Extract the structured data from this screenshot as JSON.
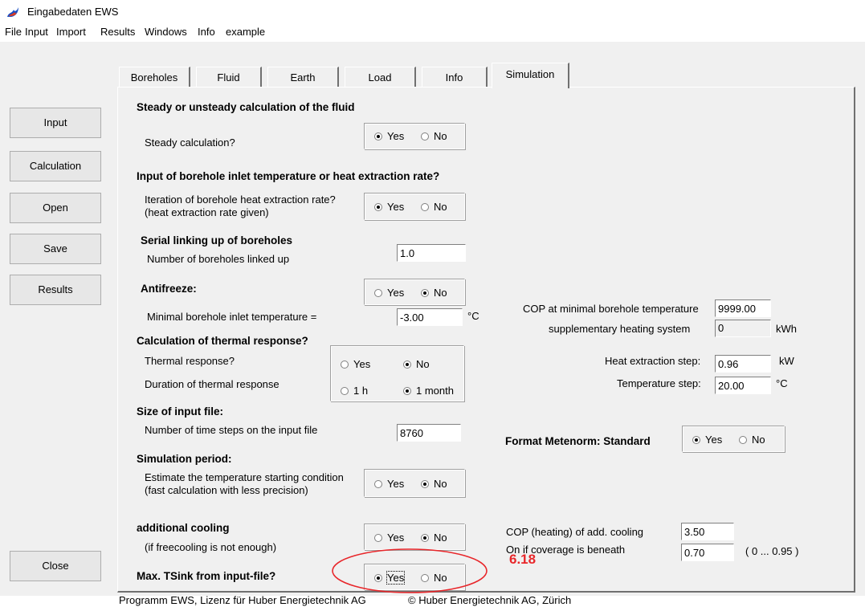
{
  "window": {
    "title": "Eingabedaten EWS"
  },
  "menu": [
    "File",
    "Input",
    "Import",
    "Results",
    "Windows",
    "Info",
    "example"
  ],
  "side_buttons": {
    "input": "Input",
    "calculation": "Calculation",
    "open": "Open",
    "save": "Save",
    "results": "Results",
    "close": "Close"
  },
  "tabs": [
    "Boreholes",
    "Fluid",
    "Earth",
    "Load",
    "Info",
    "Simulation"
  ],
  "active_tab": "Simulation",
  "yes": "Yes",
  "no": "No",
  "sections": {
    "steady": {
      "title": "Steady or unsteady calculation of the fluid",
      "question": "Steady calculation?",
      "selected": "Yes"
    },
    "inlet": {
      "title": "Input of borehole inlet temperature or heat extraction rate?",
      "q1": "Iteration of borehole heat extraction rate?",
      "q2": "(heat extraction rate given)",
      "selected": "Yes"
    },
    "serial": {
      "title": "Serial linking up of boreholes",
      "label": "Number of boreholes linked up",
      "value": "1.0"
    },
    "antifreeze": {
      "title": "Antifreeze:",
      "selected": "No",
      "label": "Minimal borehole inlet temperature =",
      "value": "-3.00",
      "unit": "°C"
    },
    "cop": {
      "label": "COP at minimal borehole temperature",
      "value": "9999.00",
      "supp_label": "supplementary heating system",
      "supp_value": "0",
      "supp_unit": "kWh"
    },
    "thermal": {
      "title": "Calculation of thermal response?",
      "q1": "Thermal response?",
      "q1_selected": "No",
      "q2": "Duration of thermal response",
      "opt_1h": "1 h",
      "opt_1month": "1 month",
      "q2_selected": "1 month",
      "heat_step_label": "Heat extraction step:",
      "heat_step_value": "0.96",
      "heat_step_unit": "kW",
      "temp_step_label": "Temperature step:",
      "temp_step_value": "20.00",
      "temp_step_unit": "°C"
    },
    "inputfile": {
      "title": "Size of input file:",
      "label": "Number of time steps on the input file",
      "value": "8760"
    },
    "meteonorm": {
      "title": "Format Metenorm: Standard",
      "selected": "Yes"
    },
    "simperiod": {
      "title": "Simulation period:",
      "q1": "Estimate the temperature starting condition",
      "q2": "(fast calculation with less precision)",
      "selected": "No"
    },
    "cooling": {
      "title": "additional cooling",
      "sub": "(if freecooling is not enough)",
      "selected": "No",
      "cop_label": "COP (heating) of add. cooling",
      "cop_value": "3.50",
      "on_label": "On if coverage is beneath",
      "on_value": "0.70",
      "range": "( 0 ... 0.95 )"
    },
    "tsink": {
      "title": "Max. TSink from input-file?",
      "selected": "Yes"
    }
  },
  "annotation": {
    "text": "6.18",
    "color": "#e8262a"
  },
  "status": {
    "left": "Programm EWS, Lizenz für Huber Energietechnik AG",
    "right": "© Huber Energietechnik AG, Zürich"
  }
}
